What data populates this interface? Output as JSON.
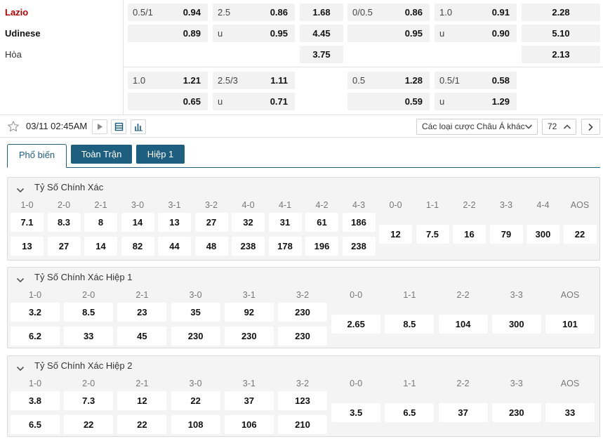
{
  "match": {
    "home_team": "Lazio",
    "away_team": "Udinese",
    "draw_label": "Hòa"
  },
  "odds": {
    "row1": {
      "hc1_line": "0.5/1",
      "hc1_odd": "0.94",
      "ou1_line": "2.5",
      "ou1_odd": "0.86",
      "x1": "1.68",
      "hc2_line": "0/0.5",
      "hc2_odd": "0.86",
      "ou2_line": "1.0",
      "ou2_odd": "0.91",
      "x2": "2.28"
    },
    "row2": {
      "hc1_odd": "0.89",
      "ou1_line": "u",
      "ou1_odd": "0.95",
      "x1": "4.45",
      "hc2_odd": "0.95",
      "ou2_line": "u",
      "ou2_odd": "0.90",
      "x2": "5.10"
    },
    "row3": {
      "x1": "3.75",
      "x2": "2.13"
    },
    "row4": {
      "hc1_line": "1.0",
      "hc1_odd": "1.21",
      "ou1_line": "2.5/3",
      "ou1_odd": "1.11",
      "hc2_line": "0.5",
      "hc2_odd": "1.28",
      "ou2_line": "0.5/1",
      "ou2_odd": "0.58"
    },
    "row5": {
      "hc1_odd": "0.65",
      "ou1_line": "u",
      "ou1_odd": "0.71",
      "hc2_odd": "0.59",
      "ou2_line": "u",
      "ou2_odd": "1.29"
    }
  },
  "toolbar": {
    "time": "03/11 02:45AM",
    "market_select": "Các loại cược Châu Á khác",
    "market_count": "72",
    "icons": [
      "star-icon",
      "play-icon",
      "list-icon",
      "stats-icon",
      "chevron-down-icon",
      "chevron-up-icon",
      "chevron-right-icon"
    ]
  },
  "tabs": {
    "popular": "Phổ biến",
    "full_match": "Toàn Trận",
    "half1": "Hiệp 1"
  },
  "sections": {
    "exact": {
      "title": "Tỷ Số Chính Xác",
      "headers": [
        "1-0",
        "2-0",
        "2-1",
        "3-0",
        "3-1",
        "3-2",
        "4-0",
        "4-1",
        "4-2",
        "4-3",
        "0-0",
        "1-1",
        "2-2",
        "3-3",
        "4-4",
        "AOS"
      ],
      "home": [
        "7.1",
        "8.3",
        "8",
        "14",
        "13",
        "27",
        "32",
        "31",
        "61",
        "186"
      ],
      "away": [
        "13",
        "27",
        "14",
        "82",
        "44",
        "48",
        "238",
        "178",
        "196",
        "238"
      ],
      "draws": [
        "12",
        "7.5",
        "16",
        "79",
        "300",
        "22"
      ]
    },
    "half1": {
      "title": "Tỷ Số Chính Xác Hiệp 1",
      "headers": [
        "1-0",
        "2-0",
        "2-1",
        "3-0",
        "3-1",
        "3-2",
        "0-0",
        "1-1",
        "2-2",
        "3-3",
        "AOS"
      ],
      "home": [
        "3.2",
        "8.5",
        "23",
        "35",
        "92",
        "230"
      ],
      "away": [
        "6.2",
        "33",
        "45",
        "230",
        "230",
        "230"
      ],
      "draws": [
        "2.65",
        "8.5",
        "104",
        "300",
        "101"
      ]
    },
    "half2": {
      "title": "Tỷ Số Chính Xác Hiệp 2",
      "headers": [
        "1-0",
        "2-0",
        "2-1",
        "3-0",
        "3-1",
        "3-2",
        "0-0",
        "1-1",
        "2-2",
        "3-3",
        "AOS"
      ],
      "home": [
        "3.8",
        "7.3",
        "12",
        "22",
        "37",
        "123"
      ],
      "away": [
        "6.5",
        "22",
        "22",
        "108",
        "106",
        "210"
      ],
      "draws": [
        "3.5",
        "6.5",
        "37",
        "230",
        "33"
      ]
    }
  }
}
